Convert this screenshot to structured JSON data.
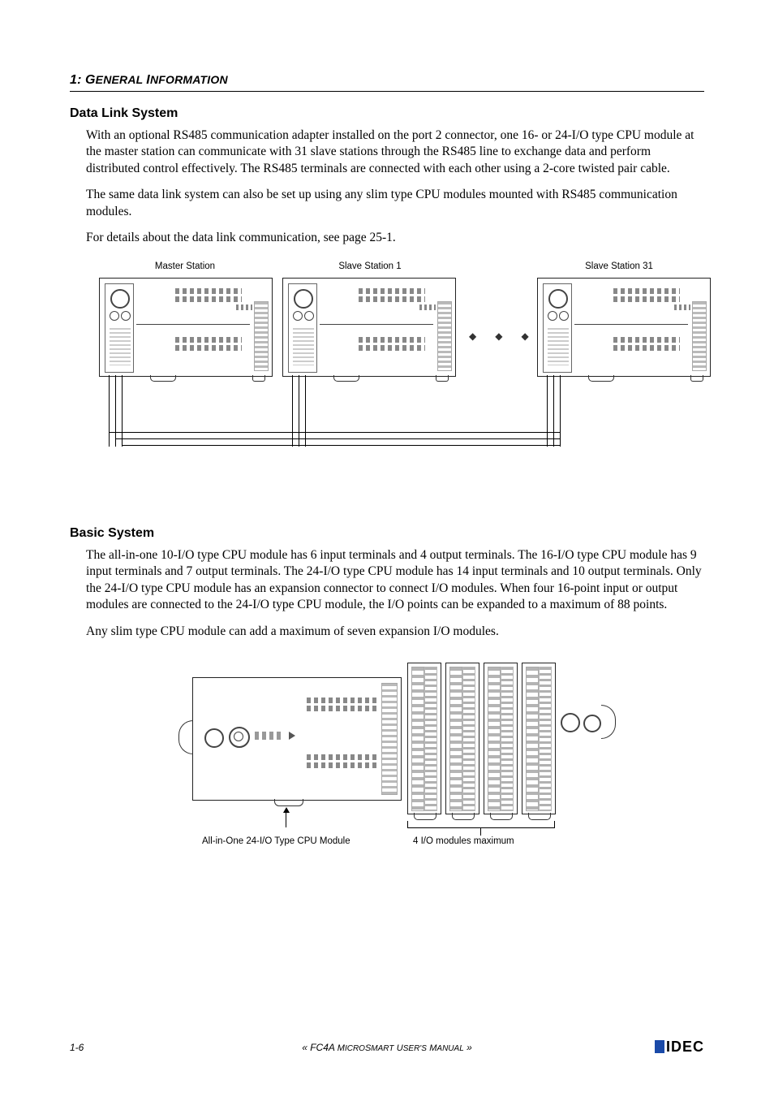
{
  "header": {
    "chapter_num": "1:",
    "chapter_title_1": "General",
    "chapter_title_2": "Information"
  },
  "section1": {
    "title": "Data Link System",
    "p1": "With an optional RS485 communication adapter installed on the port 2 connector, one 16- or 24-I/O type CPU module at the master station can communicate with 31 slave stations through the RS485 line to exchange data and perform distributed control effectively. The RS485 terminals are connected with each other using a 2-core twisted pair cable.",
    "p2": "The same data link system can also be set up using any slim type CPU modules mounted with RS485 communication modules.",
    "p3": "For details about the data link communication, see page 25-1."
  },
  "diagram1": {
    "master": "Master Station",
    "slave1": "Slave Station 1",
    "slave31": "Slave Station 31"
  },
  "section2": {
    "title": "Basic System",
    "p1": "The all-in-one 10-I/O type CPU module has 6 input terminals and 4 output terminals. The 16-I/O type CPU module has 9 input terminals and 7 output terminals. The 24-I/O type CPU module has 14 input terminals and 10 output terminals. Only the 24-I/O type CPU module has an expansion connector to connect I/O modules. When four 16-point input or output modules are connected to the 24-I/O type CPU module, the I/O points can be expanded to a maximum of 88 points.",
    "p2": "Any slim type CPU module can add a maximum of seven expansion I/O modules."
  },
  "diagram2": {
    "cpu_label": "All-in-One 24-I/O Type CPU Module",
    "exp_label": "4 I/O modules maximum"
  },
  "footer": {
    "page": "1-6",
    "manual_prefix": "« FC4A",
    "manual_mid": "MicroSmart User's Manual",
    "manual_suffix": "»",
    "brand": "IDEC"
  }
}
